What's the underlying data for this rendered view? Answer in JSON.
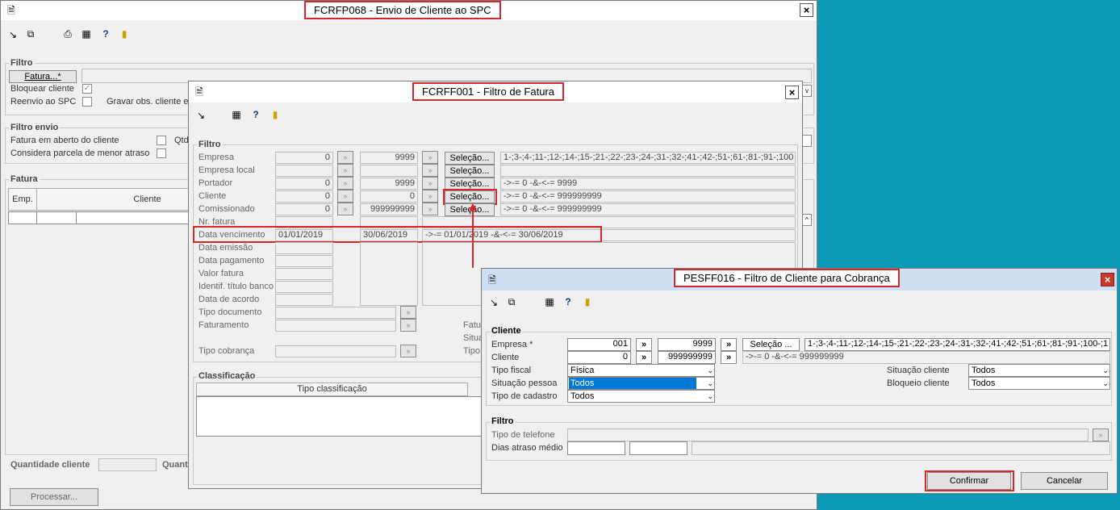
{
  "main": {
    "title": "FCRFP068 - Envio de Cliente ao SPC",
    "close": "×",
    "filtro": {
      "group": "Filtro",
      "fatura_btn": "Fatura...*",
      "bloquear": "Bloquear cliente",
      "reenvio": "Reenvio ao SPC",
      "gravar": "Gravar obs. cliente e"
    },
    "filtro_envio": {
      "group": "Filtro envio",
      "fatura_aberto": "Fatura em aberto do cliente",
      "parcela": "Considera parcela de menor atraso",
      "qtd": "Qtd"
    },
    "fatura": {
      "group": "Fatura",
      "col_emp": "Emp.",
      "col_cliente": "Cliente"
    },
    "qtd_cliente": "Quantidade cliente",
    "quant": "Quant",
    "processar": "Processar..."
  },
  "fat": {
    "title": "FCRFF001 - Filtro de Fatura",
    "close": "×",
    "group": "Filtro",
    "sel": "Seleção...",
    "rows": [
      {
        "label": "Empresa",
        "from": "0",
        "to": "9999",
        "text": "1-;3-;4-;11-;12-;14-;15-;21-;22-;23-;24-;31-;32-;41-;42-;51-;61-;81-;91-;100"
      },
      {
        "label": "Empresa local",
        "from": "",
        "to": "",
        "text": ""
      },
      {
        "label": "Portador",
        "from": "0",
        "to": "9999",
        "text": "->-= 0 -&-<-= 9999"
      },
      {
        "label": "Cliente",
        "from": "0",
        "to": "0",
        "text": "->-= 0 -&-<-= 999999999"
      },
      {
        "label": "Comissionado",
        "from": "0",
        "to": "999999999",
        "text": "->-= 0 -&-<-= 999999999"
      }
    ],
    "nr_fatura": "Nr. fatura",
    "data_venc": {
      "label": "Data vencimento",
      "from": "01/01/2019",
      "to": "30/06/2019",
      "text": "->-= 01/01/2019 -&-<-= 30/06/2019"
    },
    "date_labels": [
      "Data emissão",
      "Data pagamento",
      "Valor fatura",
      "Identif. título banco",
      "Data de acordo"
    ],
    "tipo_doc": "Tipo documento",
    "faturamento": "Faturamento",
    "tipo_cobranca": "Tipo cobrança",
    "fatu": "Fatu",
    "situa": "Situa",
    "tipo": "Tipo",
    "classificacao": "Classificação",
    "tipo_classificacao": "Tipo classificação"
  },
  "pes": {
    "title": "PESFF016 - Filtro de Cliente para Cobrança",
    "close": "×",
    "cliente_group": "Cliente",
    "empresa_label": "Empresa *",
    "empresa_from": "001",
    "empresa_to": "9999",
    "arrow": "»",
    "sel_btn": "Seleção ...",
    "empresa_text": "1-;3-;4-;11-;12-;14-;15-;21-;22-;23-;24-;31-;32-;41-;42-;51-;61-;81-;91-;100-;1",
    "cliente_label": "Cliente",
    "cliente_from": "0",
    "cliente_to": "999999999",
    "cliente_text": "->-= 0 -&-<-= 999999999",
    "tipo_fiscal_label": "Tipo fiscal",
    "tipo_fiscal": "Física",
    "situacao_pessoa_label": "Situação pessoa",
    "situacao_pessoa": "Todos",
    "tipo_cadastro_label": "Tipo de cadastro",
    "tipo_cadastro": "Todos",
    "situacao_cliente_label": "Situação cliente",
    "situacao_cliente": "Todos",
    "bloqueio_cliente_label": "Bloqueio cliente",
    "bloqueio_cliente": "Todos",
    "filtro_group": "Filtro",
    "tipo_telefone": "Tipo de telefone",
    "dias_atraso": "Dias atraso médio",
    "confirmar": "Confirmar",
    "cancelar": "Cancelar"
  },
  "colors": {
    "desktop": "#0a9ab8",
    "highlight_red": "#d9262b",
    "selection_blue": "#0078d7"
  }
}
